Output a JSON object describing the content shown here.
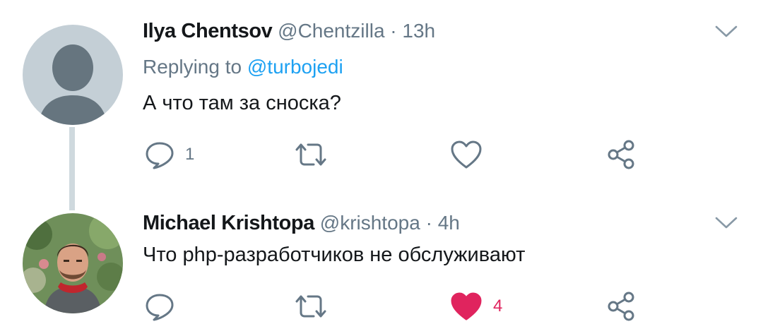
{
  "colors": {
    "text_primary": "#14171a",
    "text_secondary": "#657786",
    "mention": "#1da1f2",
    "like_active": "#e0245e",
    "thread_line": "#cfd9de"
  },
  "tweets": [
    {
      "author_name": "Ilya Chentsov",
      "author_handle": "@Chentzilla",
      "separator": "·",
      "time": "13h",
      "replying_prefix": "Replying to",
      "replying_to": "@turbojedi",
      "text": "А что там за сноска?",
      "reply_count": "1",
      "retweet_count": "",
      "like_count": "",
      "liked": false,
      "avatar_icon": "default-avatar-icon"
    },
    {
      "author_name": "Michael Krishtopa",
      "author_handle": "@krishtopa",
      "separator": "·",
      "time": "4h",
      "text": "Что php-разработчиков не обслуживают",
      "reply_count": "",
      "retweet_count": "",
      "like_count": "4",
      "liked": true,
      "avatar_icon": "user-photo-avatar"
    }
  ],
  "icons": {
    "reply": "reply-icon",
    "retweet": "retweet-icon",
    "like": "heart-icon",
    "share": "share-icon",
    "menu": "chevron-down-icon"
  }
}
